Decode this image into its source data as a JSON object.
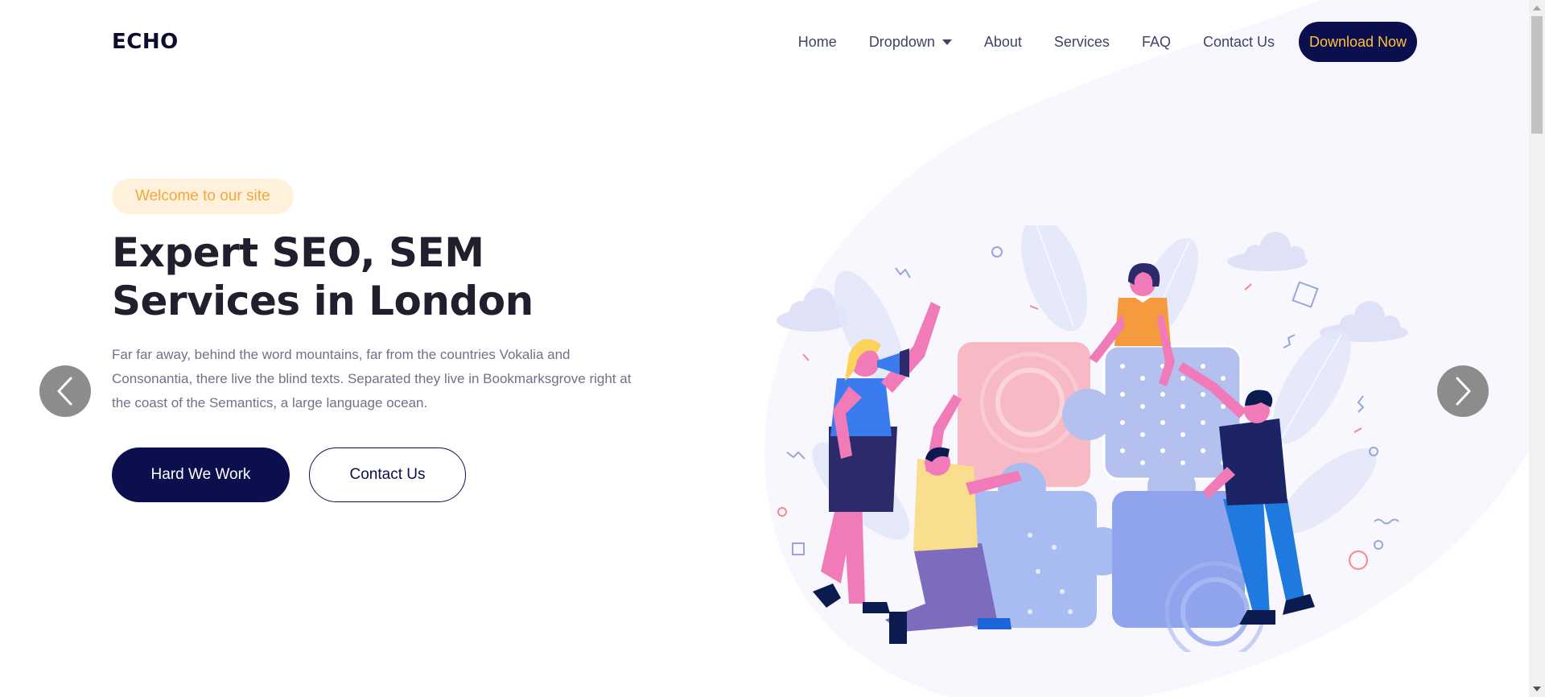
{
  "brand": {
    "logo": "ECHO"
  },
  "nav": {
    "items": [
      {
        "label": "Home"
      },
      {
        "label": "Dropdown"
      },
      {
        "label": "About"
      },
      {
        "label": "Services"
      },
      {
        "label": "FAQ"
      },
      {
        "label": "Contact Us"
      }
    ],
    "cta_label": "Download Now"
  },
  "hero": {
    "badge": "Welcome to our site",
    "title_line1": "Expert SEO, SEM",
    "title_line2": "Services in London",
    "description": "Far far away, behind the word mountains, far from the countries Vokalia and Consonantia, there live the blind texts. Separated they live in Bookmarksgrove right at the coast of the Semantics, a large language ocean.",
    "primary_button": "Hard We Work",
    "secondary_button": "Contact Us"
  },
  "carousel": {
    "prev_icon": "chevron-left-icon",
    "next_icon": "chevron-right-icon"
  },
  "colors": {
    "brand_navy": "#0c0f4e",
    "accent_orange": "#ffc33a",
    "badge_bg": "#fff1dc",
    "badge_text": "#f4a73b",
    "arrow_bg": "#8c8c8c"
  }
}
